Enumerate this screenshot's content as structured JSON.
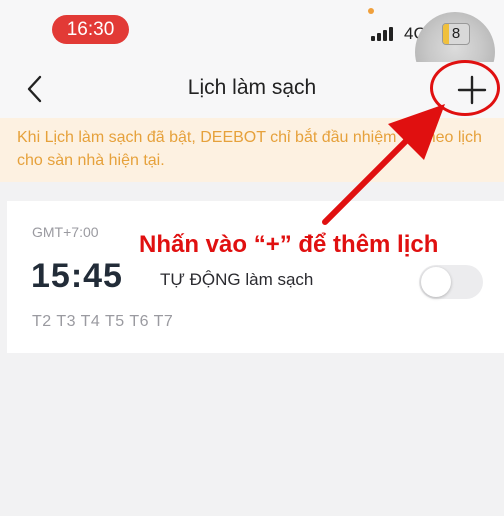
{
  "status_bar": {
    "time": "16:30",
    "network": "4G",
    "battery": "8"
  },
  "header": {
    "title": "Lịch làm sạch",
    "back_icon": "chevron-left-icon",
    "add_icon": "plus-icon"
  },
  "notice": {
    "text": "Khi Lịch làm sạch đã bật, DEEBOT chỉ bắt đầu nhiệm vụ theo lịch cho sàn nhà hiện tại."
  },
  "schedule": {
    "timezone": "GMT+7:00",
    "time": "15:45",
    "mode": "TỰ ĐỘNG làm sạch",
    "days": "T2 T3 T4 T5 T6 T7",
    "enabled": false
  },
  "annotation": {
    "text": "Nhấn vào “+” để thêm lịch",
    "color": "#e01010"
  },
  "colors": {
    "status_pill": "#e23a36",
    "notice_bg": "#fdf1e1",
    "notice_text": "#e6a13b",
    "annotation": "#e01010"
  }
}
